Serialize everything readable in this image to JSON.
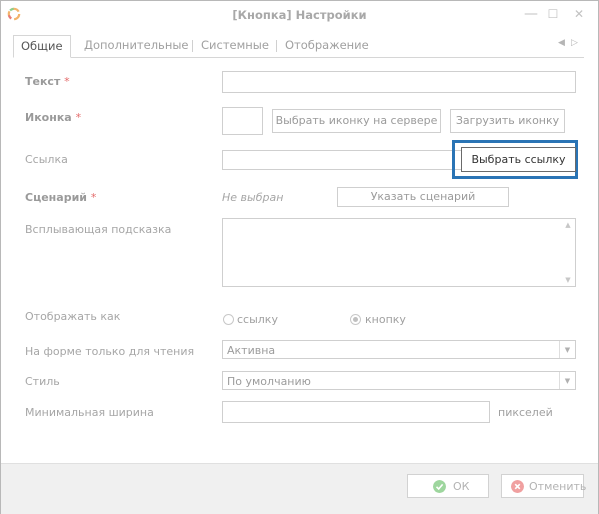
{
  "window": {
    "title": "[Кнопка] Настройки",
    "minimize_glyph": "—",
    "maximize_glyph": "☐",
    "close_glyph": "✕"
  },
  "tabs": [
    {
      "label": "Общие",
      "active": true
    },
    {
      "label": "Дополнительные",
      "active": false
    },
    {
      "label": "Системные",
      "active": false
    },
    {
      "label": "Отображение",
      "active": false
    }
  ],
  "tab_nav": {
    "prev": "◀",
    "next": "▷"
  },
  "form": {
    "text": {
      "label": "Текст",
      "required_mark": "*",
      "value": ""
    },
    "icon": {
      "label": "Иконка",
      "required_mark": "*",
      "choose_on_server_label": "Выбрать иконку на сервере",
      "upload_label": "Загрузить иконку"
    },
    "link": {
      "label": "Ссылка",
      "value": "",
      "choose_link_label": "Выбрать ссылку"
    },
    "scenario": {
      "label": "Сценарий",
      "required_mark": "*",
      "value": "Не выбран",
      "specify_label": "Указать сценарий"
    },
    "tooltip": {
      "label": "Всплывающая подсказка",
      "value": "",
      "scroll_up": "▲",
      "scroll_down": "▼"
    },
    "display_as": {
      "label": "Отображать как",
      "options": [
        {
          "label": "ссылку",
          "selected": false
        },
        {
          "label": "кнопку",
          "selected": true
        }
      ]
    },
    "readonly": {
      "label": "На форме только для чтения",
      "value": "Активна",
      "arrow": "▼"
    },
    "style": {
      "label": "Стиль",
      "value": "По умолчанию",
      "arrow": "▼"
    },
    "min_width": {
      "label": "Минимальная ширина",
      "value": "",
      "unit": "пикселей"
    }
  },
  "footer": {
    "ok_label": "ОК",
    "cancel_label": "Отменить"
  },
  "colors": {
    "accent_highlight": "#2a74b5",
    "required": "#e46b6b",
    "ok_icon": "#9ed69e",
    "cancel_icon": "#f0a0a0"
  }
}
